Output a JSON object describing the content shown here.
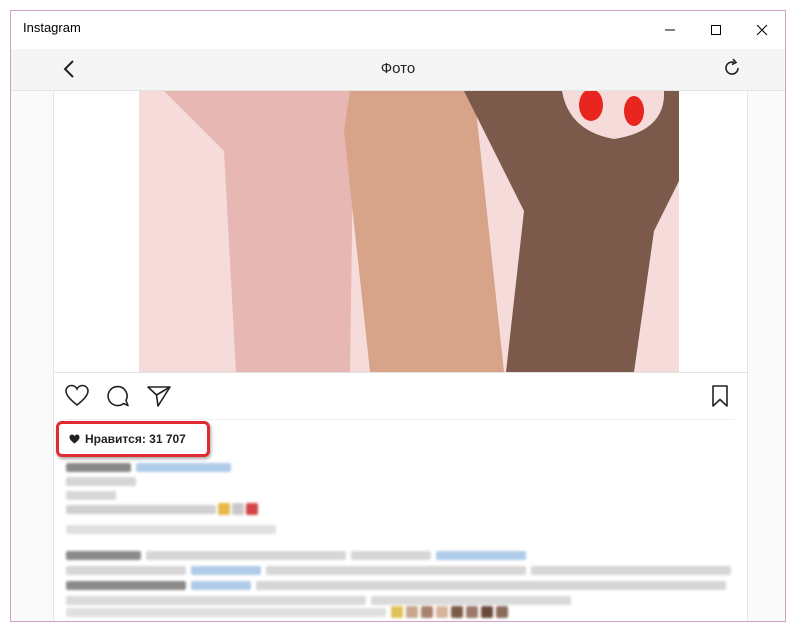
{
  "window": {
    "app_title": "Instagram",
    "controls": [
      "minimize",
      "maximize",
      "close"
    ]
  },
  "navbar": {
    "page_title": "Фото",
    "back_icon": "chevron-left-icon",
    "refresh_icon": "refresh-icon"
  },
  "post": {
    "actions": [
      "heart-icon",
      "comment-icon",
      "send-icon",
      "bookmark-icon"
    ],
    "likes_text": "Нравится: 31 707"
  },
  "colors": {
    "highlight_border": "#e02b32",
    "window_border": "#c9a3c7",
    "navbar_bg": "#f5f5f5",
    "nail_red": "#e8251f"
  }
}
